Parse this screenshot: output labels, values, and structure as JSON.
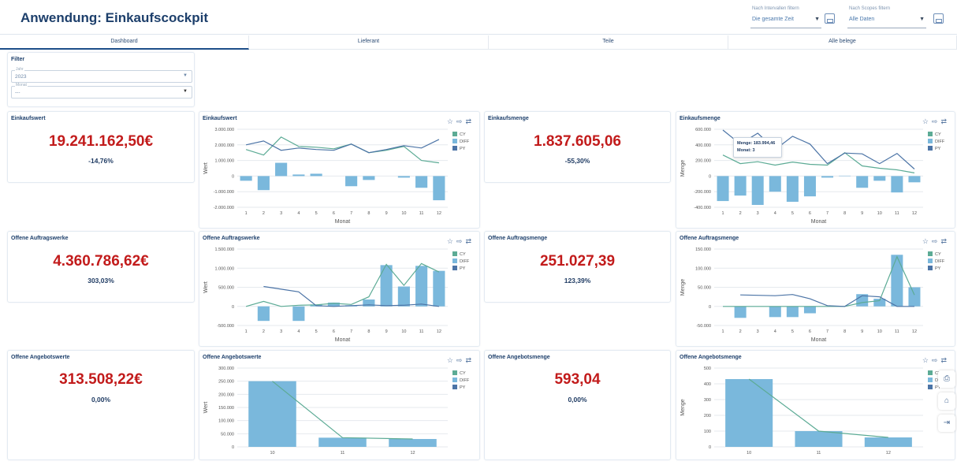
{
  "app": {
    "title": "Anwendung: Einkaufscockpit"
  },
  "top_filters": [
    {
      "label": "Nach Intervallen filtern",
      "value": "Die gesamte Zeit"
    },
    {
      "label": "Nach Scopes filtern",
      "value": "Alle Daten"
    }
  ],
  "tabs": [
    "Dashboard",
    "Lieferant",
    "Teile",
    "Alle belege"
  ],
  "filter_panel": {
    "title": "Filter",
    "fields": [
      {
        "label": "Jahr",
        "value": "2023"
      },
      {
        "label": "Monat",
        "value": "---"
      }
    ]
  },
  "kpis": [
    {
      "title": "Einkaufswert",
      "value": "19.241.162,50€",
      "change": "-14,76%"
    },
    {
      "title": "Einkaufsmenge",
      "value": "1.837.605,06",
      "change": "-55,30%"
    },
    {
      "title": "Offene Auftragswerke",
      "value": "4.360.786,62€",
      "change": "303,03%"
    },
    {
      "title": "Offene Auftragsmenge",
      "value": "251.027,39",
      "change": "123,39%"
    },
    {
      "title": "Offene Angebotswerte",
      "value": "313.508,22€",
      "change": "0,00%"
    },
    {
      "title": "Offene Angebotsmenge",
      "value": "593,04",
      "change": "0,00%"
    }
  ],
  "legend": [
    "CY",
    "DIFF",
    "PY"
  ],
  "colors": {
    "cy": "#5cab95",
    "diff": "#7ab8dc",
    "py": "#4c74a6",
    "kpi": "#c21b1b"
  },
  "tooltip": {
    "line1": "Menge: 183.994,46",
    "line2": "Monat: 3"
  },
  "chart_data": [
    {
      "title": "Einkaufswert",
      "type": "bar+line",
      "xlabel": "Monat",
      "ylabel": "Wert",
      "categories": [
        "1",
        "2",
        "3",
        "4",
        "5",
        "6",
        "7",
        "8",
        "9",
        "10",
        "11",
        "12"
      ],
      "ylim": [
        -2000000,
        3000000
      ],
      "yticks": [
        -2000000,
        -1000000,
        0,
        1000000,
        2000000,
        3000000
      ],
      "ytick_labels": [
        "-2.000.000",
        "-1.000.000",
        "0",
        "1.000.000",
        "2.000.000",
        "3.000.000"
      ],
      "series": [
        {
          "name": "CY",
          "kind": "line",
          "values": [
            1700000,
            1350000,
            2500000,
            1900000,
            1850000,
            1750000,
            2050000,
            1500000,
            1650000,
            1900000,
            1000000,
            850000
          ]
        },
        {
          "name": "DIFF",
          "kind": "bar",
          "values": [
            -300000,
            -900000,
            850000,
            100000,
            150000,
            0,
            -650000,
            -250000,
            0,
            -100000,
            -750000,
            -1550000
          ]
        },
        {
          "name": "PY",
          "kind": "line",
          "values": [
            2000000,
            2250000,
            1650000,
            1800000,
            1700000,
            1650000,
            2050000,
            1500000,
            1700000,
            1950000,
            1800000,
            2350000
          ]
        }
      ]
    },
    {
      "title": "Einkaufsmenge",
      "type": "bar+line",
      "xlabel": "Monat",
      "ylabel": "Menge",
      "categories": [
        "1",
        "2",
        "3",
        "4",
        "5",
        "6",
        "7",
        "8",
        "9",
        "10",
        "11",
        "12"
      ],
      "ylim": [
        -400000,
        600000
      ],
      "yticks": [
        -400000,
        -200000,
        0,
        200000,
        400000,
        600000
      ],
      "ytick_labels": [
        "-400.000",
        "-200.000",
        "0",
        "200.000",
        "400.000",
        "600.000"
      ],
      "series": [
        {
          "name": "CY",
          "kind": "line",
          "values": [
            270000,
            160000,
            184000,
            140000,
            180000,
            150000,
            140000,
            300000,
            130000,
            100000,
            80000,
            40000
          ]
        },
        {
          "name": "DIFF",
          "kind": "bar",
          "values": [
            -320000,
            -250000,
            -370000,
            -200000,
            -330000,
            -260000,
            -20000,
            5000,
            -150000,
            -60000,
            -210000,
            -80000
          ]
        },
        {
          "name": "PY",
          "kind": "line",
          "values": [
            590000,
            410000,
            550000,
            340000,
            510000,
            410000,
            160000,
            295000,
            285000,
            160000,
            290000,
            90000
          ]
        }
      ]
    },
    {
      "title": "Offene Auftragswerke",
      "type": "bar+line",
      "xlabel": "Monat",
      "ylabel": "Wert",
      "categories": [
        "1",
        "2",
        "3",
        "4",
        "5",
        "6",
        "7",
        "8",
        "9",
        "10",
        "11",
        "12"
      ],
      "ylim": [
        -500000,
        1500000
      ],
      "yticks": [
        -500000,
        0,
        500000,
        1000000,
        1500000
      ],
      "ytick_labels": [
        "-500.000",
        "0",
        "500.000",
        "1.000.000",
        "1.500.000"
      ],
      "series": [
        {
          "name": "CY",
          "kind": "line",
          "values": [
            0,
            130000,
            0,
            30000,
            40000,
            80000,
            50000,
            250000,
            1100000,
            550000,
            1120000,
            900000
          ]
        },
        {
          "name": "DIFF",
          "kind": "bar",
          "values": [
            0,
            -380000,
            0,
            -380000,
            50000,
            100000,
            30000,
            180000,
            1080000,
            520000,
            1060000,
            930000
          ]
        },
        {
          "name": "PY",
          "kind": "line",
          "values": [
            null,
            520000,
            450000,
            380000,
            20000,
            0,
            20000,
            40000,
            20000,
            30000,
            60000,
            0
          ]
        }
      ]
    },
    {
      "title": "Offene Auftragsmenge",
      "type": "bar+line",
      "xlabel": "Monat",
      "ylabel": "Menge",
      "categories": [
        "1",
        "2",
        "3",
        "4",
        "5",
        "6",
        "7",
        "8",
        "9",
        "10",
        "11",
        "12"
      ],
      "ylim": [
        -50000,
        150000
      ],
      "yticks": [
        -50000,
        0,
        50000,
        100000,
        150000
      ],
      "ytick_labels": [
        "-50.000",
        "0",
        "50.000",
        "100.000",
        "150.000"
      ],
      "series": [
        {
          "name": "CY",
          "kind": "line",
          "values": [
            0,
            0,
            0,
            0,
            0,
            0,
            0,
            0,
            10000,
            15000,
            130000,
            30000
          ]
        },
        {
          "name": "DIFF",
          "kind": "bar",
          "values": [
            0,
            -30000,
            0,
            -28000,
            -28000,
            -18000,
            0,
            0,
            32000,
            20000,
            135000,
            50000
          ]
        },
        {
          "name": "PY",
          "kind": "line",
          "values": [
            null,
            30000,
            29000,
            28000,
            31000,
            20000,
            2000,
            0,
            28000,
            25000,
            0,
            0
          ]
        }
      ]
    },
    {
      "title": "Offene Angebotswerte",
      "type": "bar+line",
      "xlabel": "",
      "ylabel": "Wert",
      "categories": [
        "10",
        "11",
        "12"
      ],
      "ylim": [
        0,
        300000
      ],
      "yticks": [
        0,
        50000,
        100000,
        150000,
        200000,
        250000,
        300000
      ],
      "ytick_labels": [
        "0",
        "50.000",
        "100.000",
        "150.000",
        "200.000",
        "250.000",
        "300.000"
      ],
      "series": [
        {
          "name": "CY",
          "kind": "line",
          "values": [
            250000,
            35000,
            30000
          ]
        },
        {
          "name": "DIFF",
          "kind": "bar",
          "values": [
            250000,
            35000,
            30000
          ]
        }
      ]
    },
    {
      "title": "Offene Angebotsmenge",
      "type": "bar+line",
      "xlabel": "",
      "ylabel": "Menge",
      "categories": [
        "10",
        "11",
        "12"
      ],
      "ylim": [
        0,
        500
      ],
      "yticks": [
        0,
        100,
        200,
        300,
        400,
        500
      ],
      "ytick_labels": [
        "0",
        "100",
        "200",
        "300",
        "400",
        "500"
      ],
      "series": [
        {
          "name": "CY",
          "kind": "line",
          "values": [
            430,
            100,
            60
          ]
        },
        {
          "name": "DIFF",
          "kind": "bar",
          "values": [
            430,
            100,
            60
          ]
        }
      ]
    }
  ]
}
